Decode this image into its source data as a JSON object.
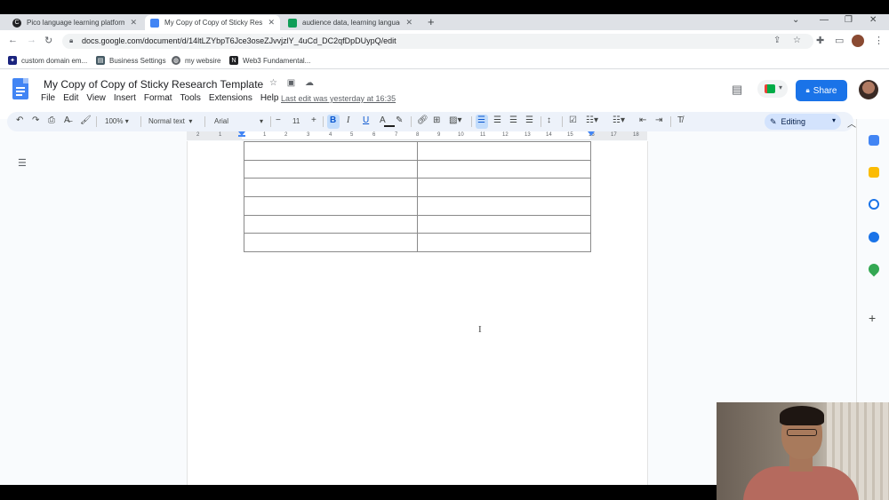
{
  "tabs": [
    {
      "title": "Pico language learning platform",
      "active": false,
      "favicon_color": "#202124",
      "favicon_glyph": "C"
    },
    {
      "title": "My Copy of Copy of Sticky Resea",
      "active": true,
      "favicon_color": "#4285f4",
      "favicon_glyph": ""
    },
    {
      "title": "audience data, learning languag",
      "active": false,
      "favicon_color": "#0f9d58",
      "favicon_glyph": ""
    }
  ],
  "address": {
    "url": "docs.google.com/document/d/14ltLZYbpT6Jce3oseZJvvjzlY_4uCd_DC2qfDpDUypQ/edit"
  },
  "bookmarks": [
    {
      "label": "custom domain em...",
      "icon": "pin-icon",
      "color": "#1a237e"
    },
    {
      "label": "Business Settings",
      "icon": "settings-icon",
      "color": "#455a64"
    },
    {
      "label": "my websire",
      "icon": "globe-icon",
      "color": "#5f6368"
    },
    {
      "label": "Web3 Fundamental...",
      "icon": "notion-icon",
      "color": "#202124"
    }
  ],
  "doc": {
    "title": "My Copy of Copy of Sticky Research Template",
    "last_edit": "Last edit was yesterday at 16:35",
    "menu": [
      "File",
      "Edit",
      "View",
      "Insert",
      "Format",
      "Tools",
      "Extensions",
      "Help"
    ],
    "share_label": "Share"
  },
  "toolbar": {
    "zoom": "100%",
    "style": "Normal text",
    "font": "Arial",
    "font_size": "11",
    "bold": "B",
    "italic": "I",
    "underline": "U",
    "text_color": "A",
    "mode": "Editing"
  },
  "ruler": {
    "labels": [
      "2",
      "1",
      "1",
      "2",
      "3",
      "4",
      "5",
      "6",
      "7",
      "8",
      "9",
      "10",
      "11",
      "12",
      "13",
      "14",
      "15",
      "16",
      "17",
      "18"
    ]
  },
  "table": {
    "rows": 6,
    "cols": 2
  },
  "colors": {
    "accent": "#1a73e8",
    "docs_blue": "#4285f4"
  }
}
